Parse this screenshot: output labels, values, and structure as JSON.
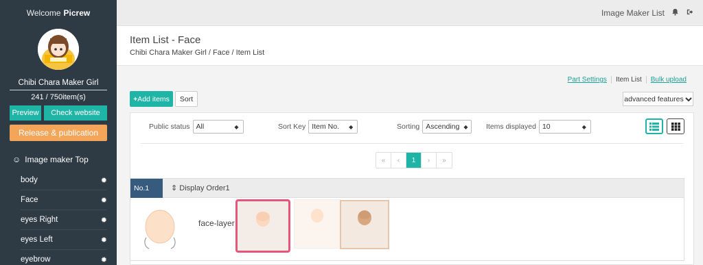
{
  "sidebar": {
    "welcome_prefix": "Welcome",
    "welcome_name": "Picrew",
    "maker_name": "Chibi Chara Maker Girl",
    "item_count": "241 / 750item(s)",
    "preview_label": "Preview",
    "check_label": "Check website",
    "release_label": "Release & publication",
    "top_label": "Image maker Top",
    "items": [
      {
        "label": "body"
      },
      {
        "label": "Face"
      },
      {
        "label": "eyes Right"
      },
      {
        "label": "eyes Left"
      },
      {
        "label": "eyebrow"
      }
    ]
  },
  "topbar": {
    "label": "Image Maker List",
    "bell_icon": "bell-icon",
    "logout_icon": "logout-icon"
  },
  "header": {
    "title": "Item List - Face",
    "breadcrumb": "Chibi Chara Maker Girl / Face / Item List"
  },
  "links": {
    "part_settings": "Part Settings",
    "item_list": "Item List",
    "bulk_upload": "Bulk upload"
  },
  "toolbar": {
    "add_label": "Add items",
    "sort_label": "Sort",
    "advanced_label": "advanced features"
  },
  "filters": {
    "public_status_label": "Public status",
    "public_status_value": "All",
    "sort_key_label": "Sort Key",
    "sort_key_value": "Item No.",
    "sorting_label": "Sorting",
    "sorting_value": "Ascending",
    "items_displayed_label": "Items displayed",
    "items_displayed_value": "10"
  },
  "pager": {
    "first": "«",
    "prev": "‹",
    "current": "1",
    "next": "›",
    "last": "»"
  },
  "layer": {
    "number": "No.1",
    "display_order": "Display Order1",
    "name": "face-layer"
  },
  "colors": {
    "accent": "#1fb5a6",
    "sidebar": "#2e3a44",
    "release": "#f3a55a",
    "selected_border": "#e8557a"
  }
}
